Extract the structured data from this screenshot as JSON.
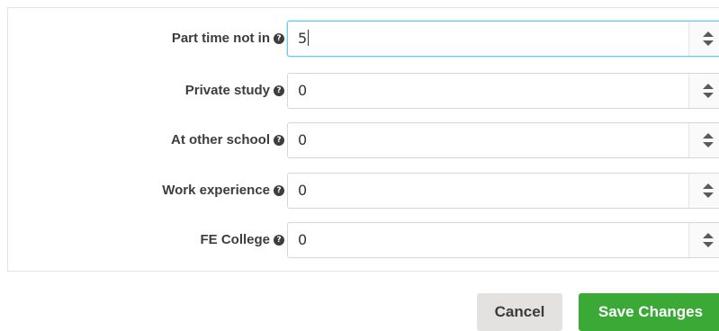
{
  "form": {
    "fields": [
      {
        "label": "Part time not in",
        "value": "5",
        "focused": true
      },
      {
        "label": "Private study",
        "value": "0",
        "focused": false
      },
      {
        "label": "At other school",
        "value": "0",
        "focused": false
      },
      {
        "label": "Work experience",
        "value": "0",
        "focused": false
      },
      {
        "label": "FE College",
        "value": "0",
        "focused": false
      }
    ],
    "help_icon_glyph": "?",
    "icons": {
      "help": "question-circle-icon",
      "spinner_up": "caret-up-icon",
      "spinner_down": "caret-down-icon"
    }
  },
  "actions": {
    "cancel_label": "Cancel",
    "save_label": "Save Changes"
  },
  "colors": {
    "save_button": "#3aa935",
    "cancel_button": "#e4e2e0",
    "focus_border": "#6ccbe6"
  }
}
